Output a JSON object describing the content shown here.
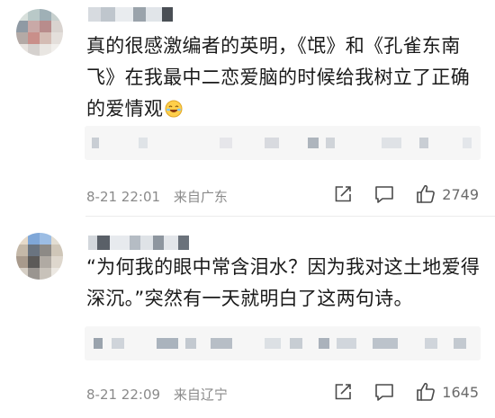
{
  "comments": [
    {
      "username": "",
      "text_before_emoji": "真的很感激编者的英明，《氓》和《孔雀东南飞》在我最中二恋爱脑的时候给我树立了正确的爱情观",
      "emoji": "laughing-emoji-icon",
      "date": "8-21 22:01",
      "location": "来自广东",
      "likes": "2749"
    },
    {
      "username": "",
      "text_before_emoji": "“为何我的眼中常含泪水？因为我对这土地爱得深沉。”突然有一天就明白了这两句诗。",
      "date": "8-21 22:09",
      "location": "来自辽宁",
      "likes": "1645"
    }
  ],
  "icons": {
    "share": "share-icon",
    "comment": "comment-icon",
    "like": "thumbs-up-icon"
  },
  "colors": {
    "meta_gray": "#8a8a8a",
    "icon_gray": "#4a4a4a",
    "blur_bg": "#f6f6f6"
  }
}
